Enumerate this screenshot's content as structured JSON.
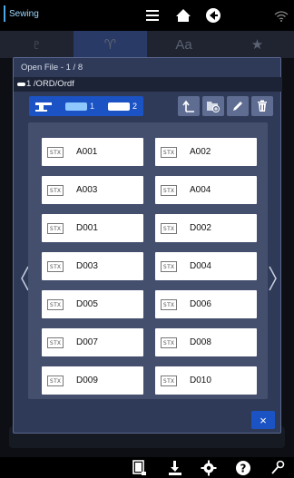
{
  "app": {
    "title": "Sewing"
  },
  "topbar": {
    "icons": [
      "menu-icon",
      "home-icon",
      "back-icon",
      "wifi-icon"
    ]
  },
  "background_tabs": [
    "♇",
    "♈",
    "Aa",
    "★"
  ],
  "dialog": {
    "title": "Open File - 1 / 8",
    "path": "1 /ORD/Ordf",
    "devices": [
      {
        "name": "machine",
        "label": ""
      },
      {
        "name": "usb1",
        "label": "1"
      },
      {
        "name": "usb2",
        "label": "2"
      }
    ],
    "tools": [
      "up-folder-icon",
      "new-folder-icon",
      "rename-icon",
      "delete-icon"
    ],
    "file_tag": "STX",
    "files": [
      "A001",
      "A002",
      "A003",
      "A004",
      "D001",
      "D002",
      "D003",
      "D004",
      "D005",
      "D006",
      "D007",
      "D008",
      "D009",
      "D010"
    ],
    "close_label": "×"
  },
  "bottombar": {
    "icons": [
      "frame-icon",
      "download-icon",
      "settings-icon",
      "help-icon",
      "tool-icon"
    ]
  },
  "colors": {
    "accent": "#1c53c4",
    "dialog_bg": "#2f3a58",
    "panel_bg": "#444f6e"
  }
}
